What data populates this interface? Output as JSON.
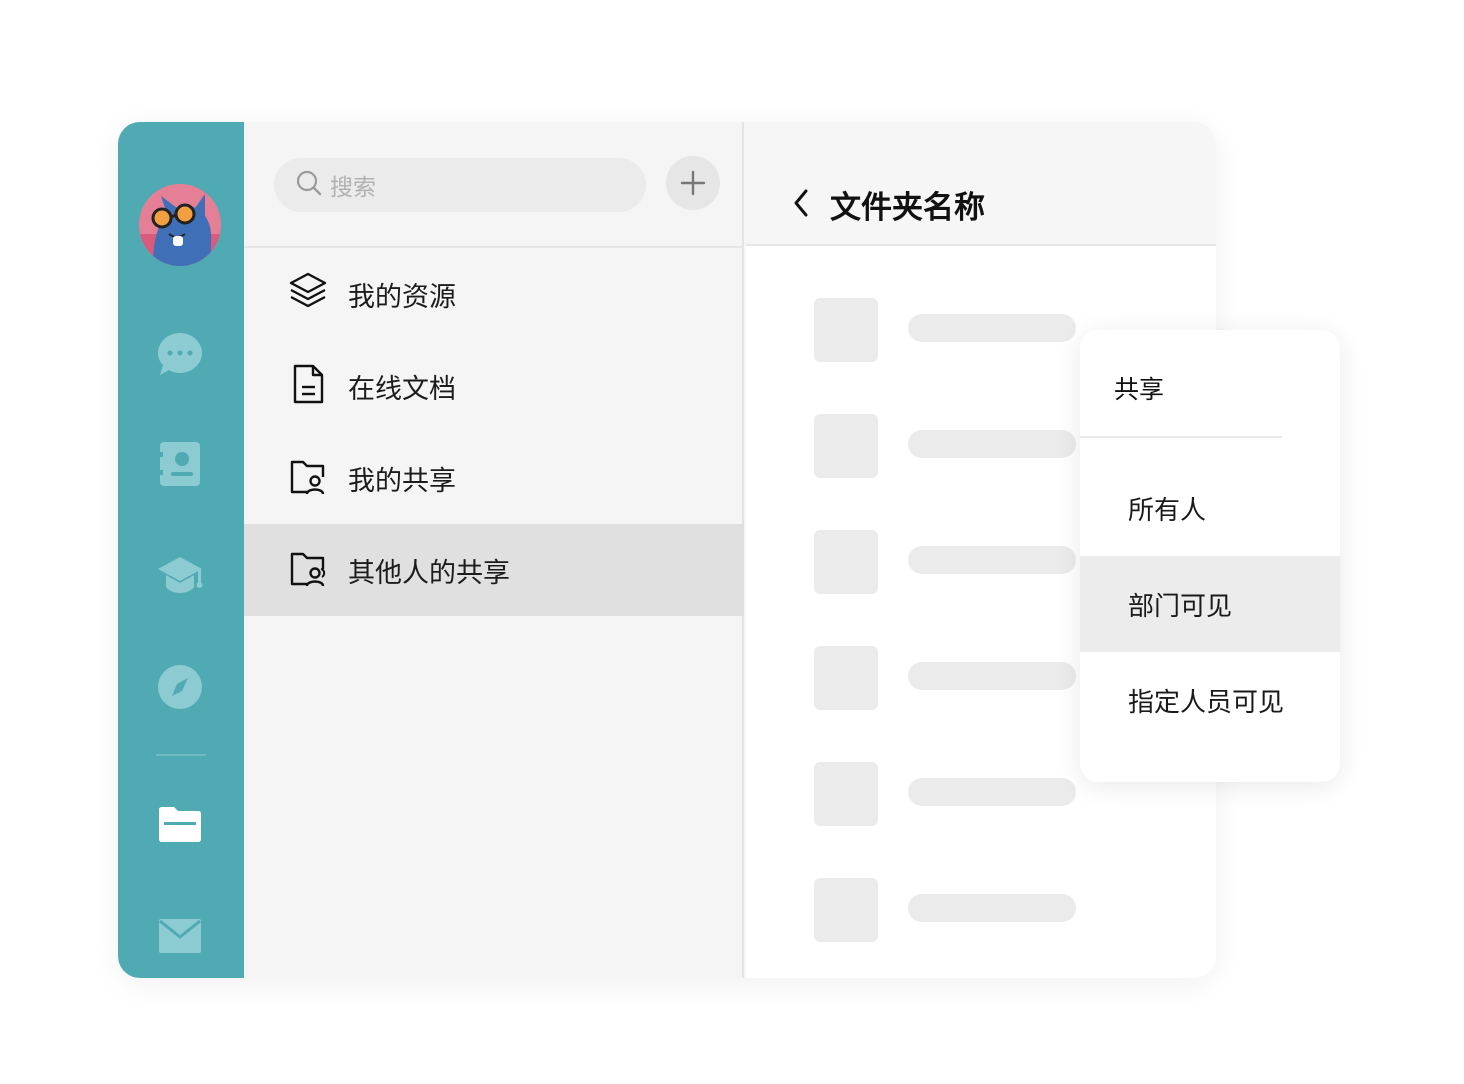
{
  "search": {
    "placeholder": "搜索"
  },
  "nav": {
    "items": [
      {
        "label": "我的资源",
        "icon": "layers-icon"
      },
      {
        "label": "在线文档",
        "icon": "document-icon"
      },
      {
        "label": "我的共享",
        "icon": "shared-folder-icon"
      },
      {
        "label": "其他人的共享",
        "icon": "others-shared-folder-icon",
        "active": true
      }
    ]
  },
  "folder": {
    "title": "文件夹名称"
  },
  "popup": {
    "title": "共享",
    "options": [
      "所有人",
      "部门可见",
      "指定人员可见"
    ],
    "selected": "部门可见"
  },
  "colors": {
    "rail": "#4faab3",
    "railIcon": "#8ccbd1",
    "activeRailIcon": "#ffffff"
  }
}
